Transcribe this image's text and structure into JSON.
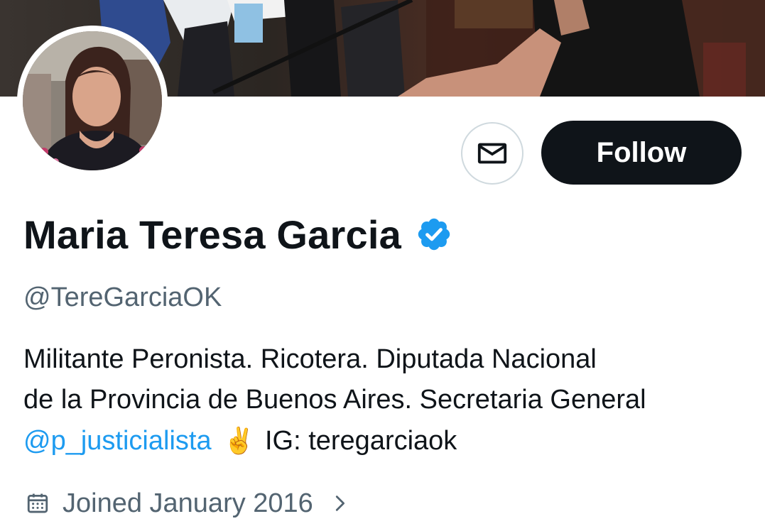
{
  "profile": {
    "name": "Maria Teresa Garcia",
    "handle": "@TereGarciaOK",
    "bio": {
      "line1": "Militante Peronista.  Ricotera.  Diputada Nacional",
      "line2": "de la Provincia de Buenos Aires. Secretaria General",
      "mention": "@p_justicialista",
      "emoji": "✌️",
      "line3_rest": "IG: teregarciaok"
    },
    "joined": "Joined January 2016",
    "verified": true
  },
  "actions": {
    "follow_label": "Follow",
    "message_icon": "envelope-icon"
  },
  "icons": {
    "verified": "verified-badge-icon",
    "calendar": "calendar-icon",
    "chevron": "chevron-right-icon"
  },
  "colors": {
    "accent": "#1d9bf0",
    "text_primary": "#0f1419",
    "text_secondary": "#536471",
    "button_dark": "#0f1419"
  }
}
